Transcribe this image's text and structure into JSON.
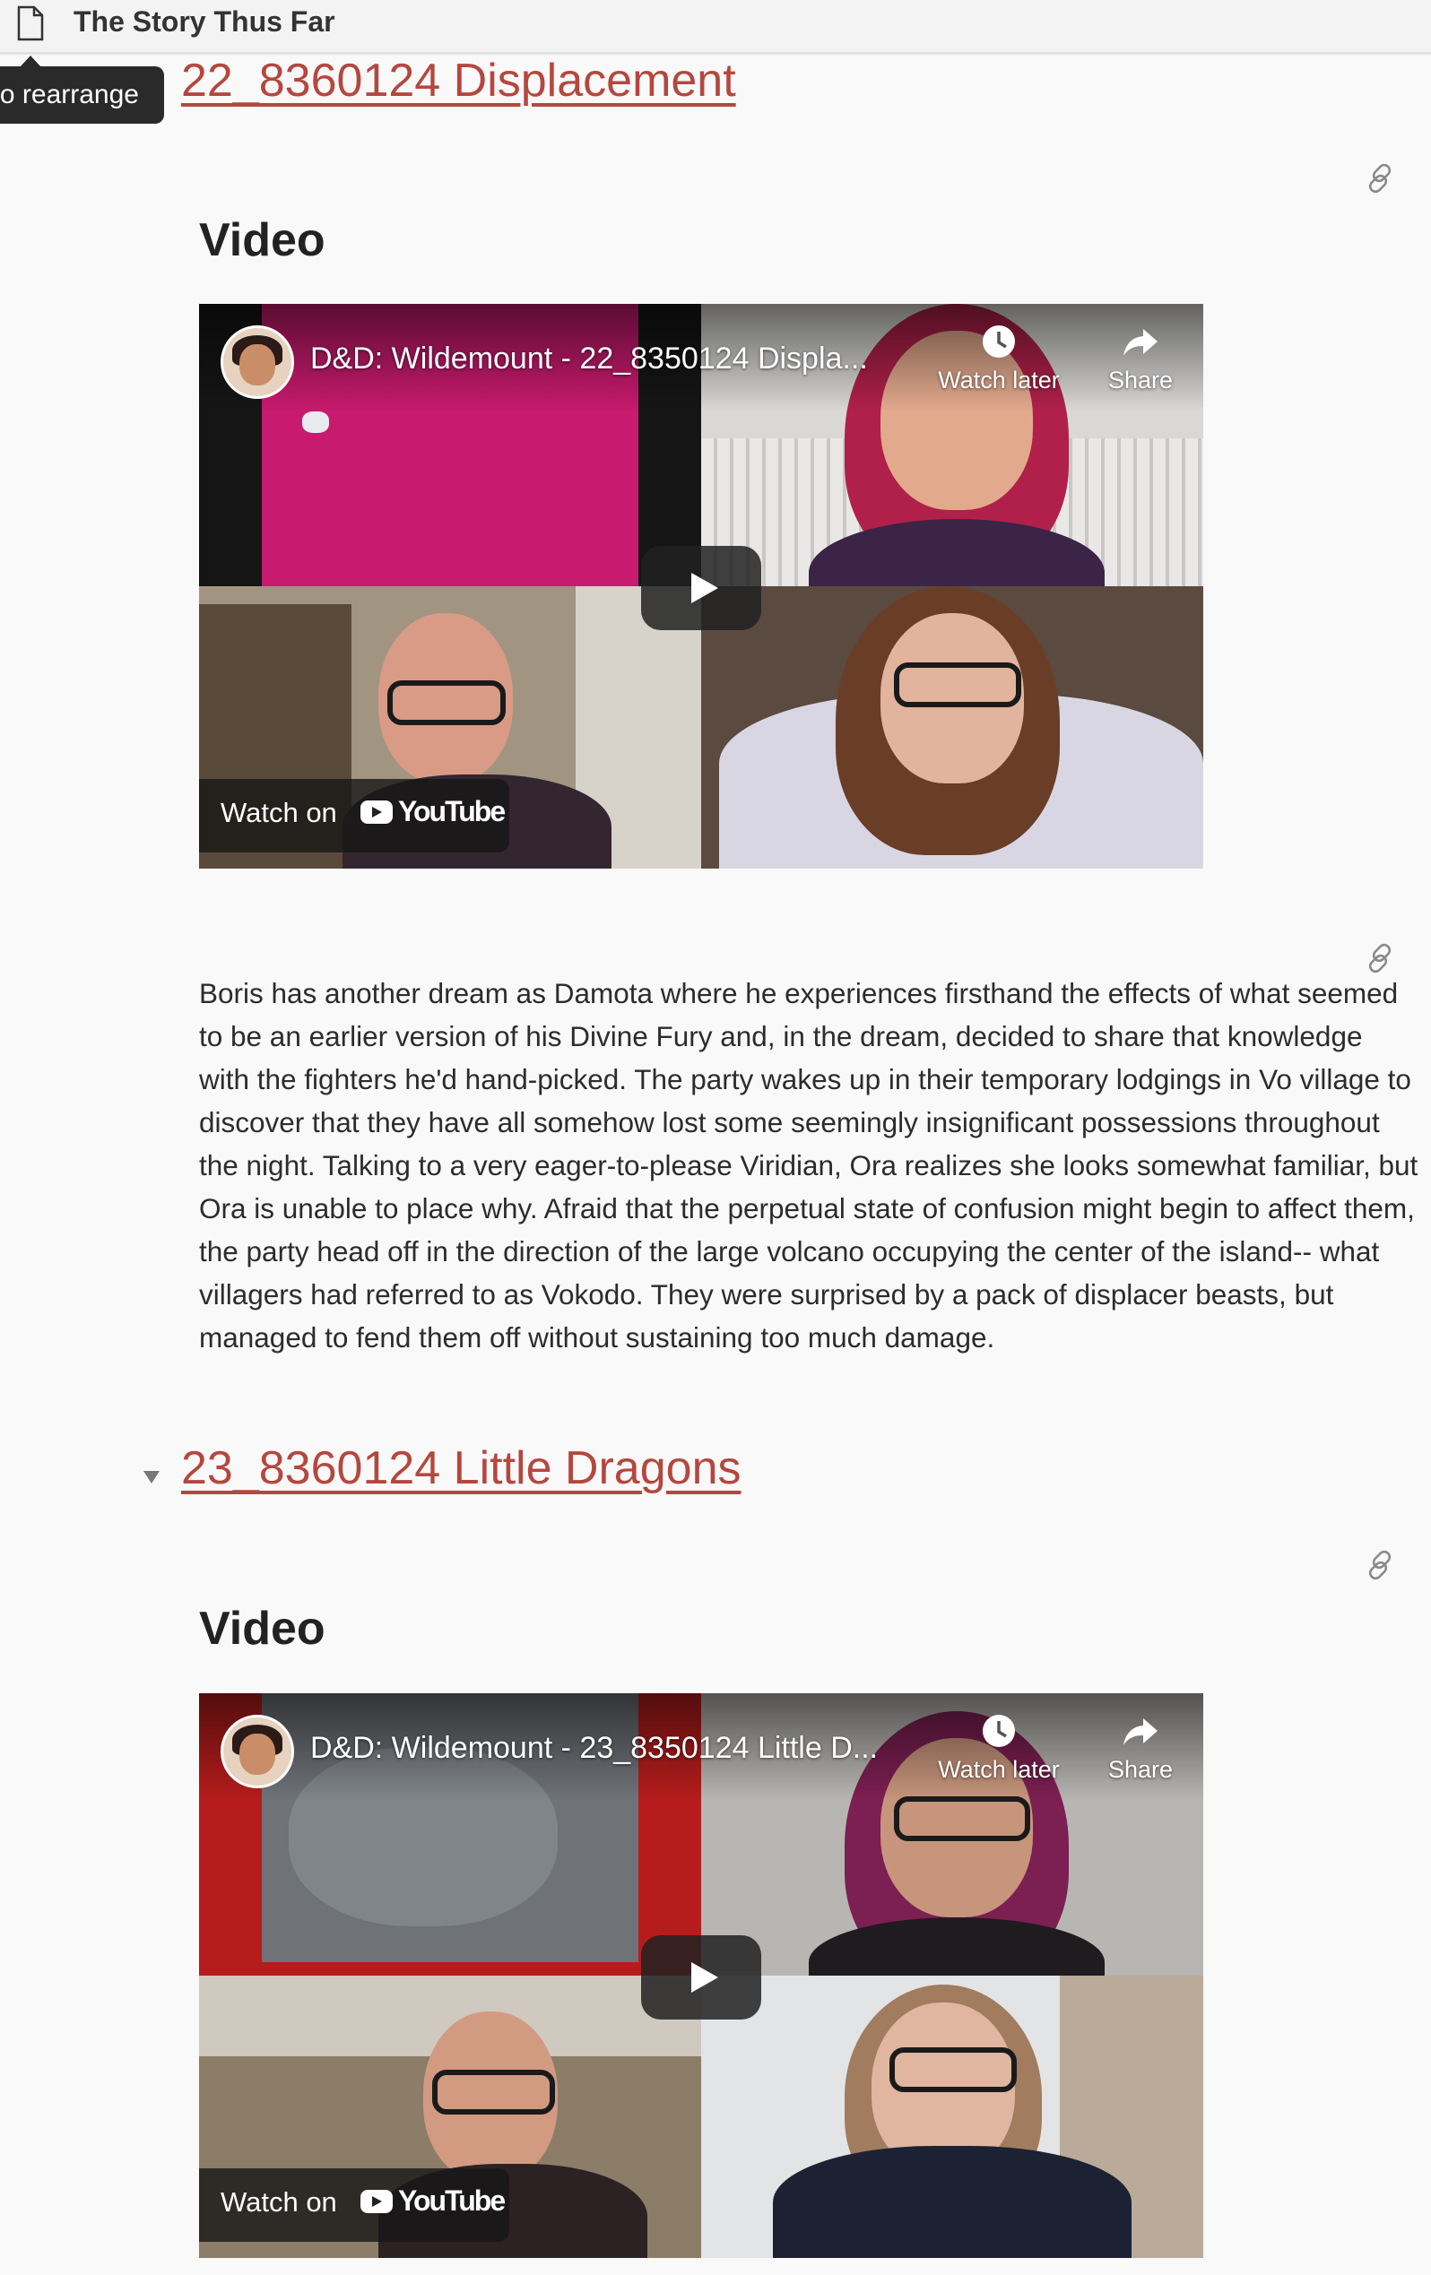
{
  "topbar": {
    "title": "The Story Thus Far",
    "icon": "document-icon"
  },
  "tooltip": {
    "text": "o rearrange"
  },
  "sections": [
    {
      "title": "22_8360124 Displacement",
      "video_heading": "Video",
      "video": {
        "title": "D&D: Wildemount - 22_8350124 Displa...",
        "watch_later": "Watch later",
        "share": "Share",
        "watch_on": "Watch on",
        "youtube": "YouTube"
      },
      "summary": "Boris has another dream as Damota where he experiences firsthand the effects of what seemed to be an earlier version of his Divine Fury and, in the dream, decided to share that knowledge with the fighters he'd hand-picked. The party wakes up in their temporary lodgings in Vo village to discover that they have all somehow lost some seemingly insignificant possessions throughout the night. Talking to a very eager-to-please Viridian, Ora realizes she looks somewhat familiar, but Ora is unable to place why. Afraid that the perpetual state of confusion might begin to affect them, the party head off in the direction of the large volcano occupying the center of the island-- what villagers had referred to as Vokodo. They were surprised by a pack of displacer beasts, but managed to fend them off without sustaining too much damage."
    },
    {
      "title": "23_8360124 Little Dragons",
      "video_heading": "Video",
      "video": {
        "title": "D&D: Wildemount - 23_8350124 Little D...",
        "watch_later": "Watch later",
        "share": "Share",
        "watch_on": "Watch on",
        "youtube": "YouTube"
      }
    }
  ],
  "colors": {
    "link": "#b5473f",
    "background": "#f9f9f9",
    "map_magenta": "#c81a6e",
    "map_grey": "#6f7378"
  }
}
